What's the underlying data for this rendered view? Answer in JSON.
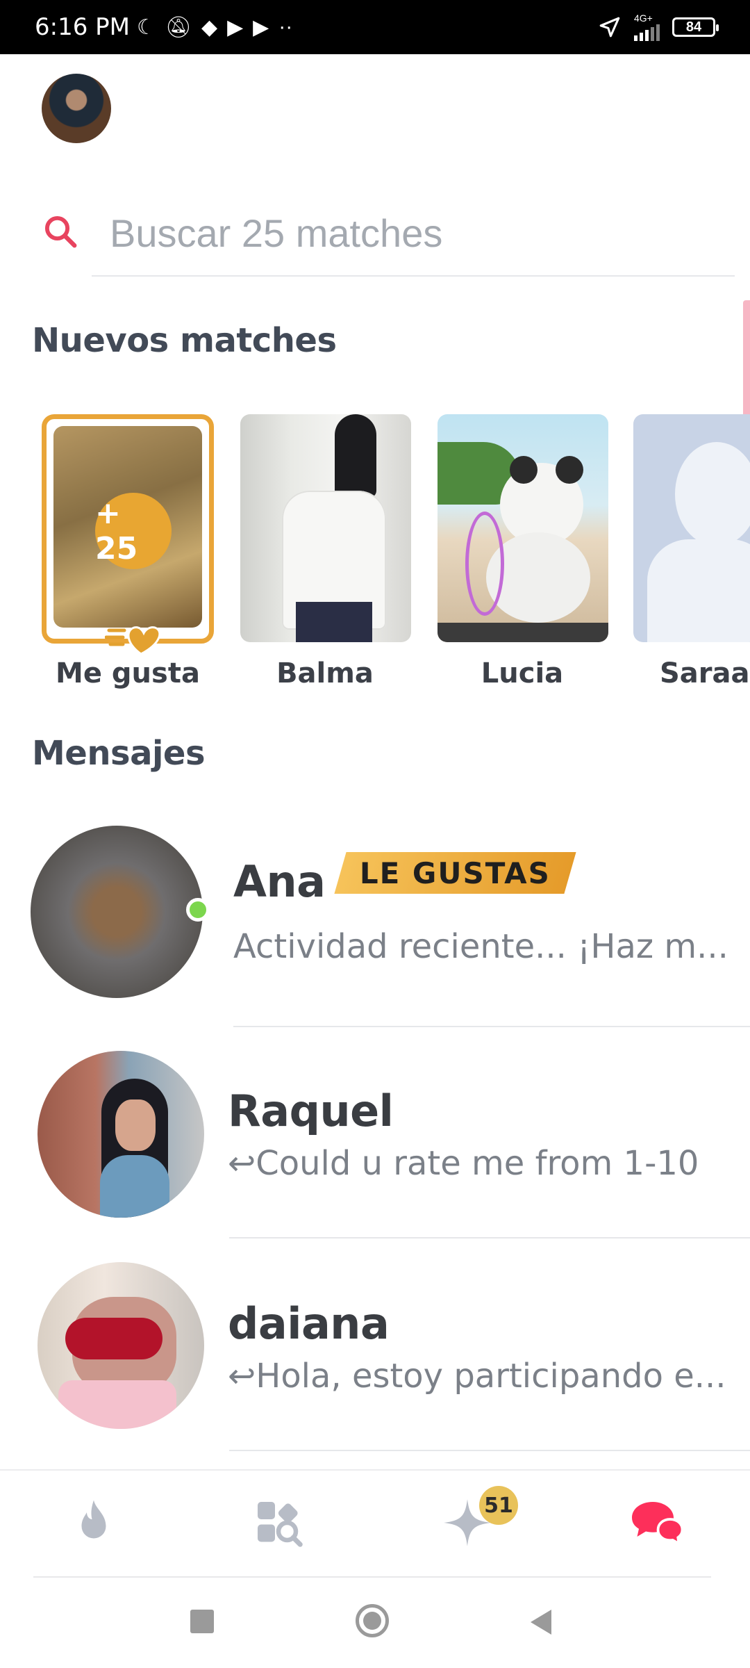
{
  "status_bar": {
    "time": "6:16 PM",
    "network": "4G+",
    "battery": "84"
  },
  "search": {
    "placeholder": "Buscar 25 matches"
  },
  "sections": {
    "new_matches": "Nuevos matches",
    "messages": "Mensajes"
  },
  "new_matches": {
    "likes_card": {
      "count": "+ 25",
      "label": "Me gusta"
    },
    "items": [
      {
        "name": "Balma"
      },
      {
        "name": "Lucia"
      },
      {
        "name": "Saraa"
      }
    ]
  },
  "messages": [
    {
      "name": "Ana",
      "badge": "LE GUSTAS",
      "preview": "Actividad reciente... ¡Haz m...",
      "online": true
    },
    {
      "name": "Raquel",
      "preview": "↩Could u rate me from 1-10"
    },
    {
      "name": "daiana",
      "preview": "↩Hola, estoy participando e..."
    }
  ],
  "bottom_nav": {
    "items": [
      "flame-icon",
      "explore-icon",
      "gold-star-icon",
      "chat-icon"
    ],
    "badge": "51",
    "colors": {
      "inactive": "#b7bcc6",
      "active": "#fd2f5a",
      "gold": "#e8c25a"
    }
  }
}
